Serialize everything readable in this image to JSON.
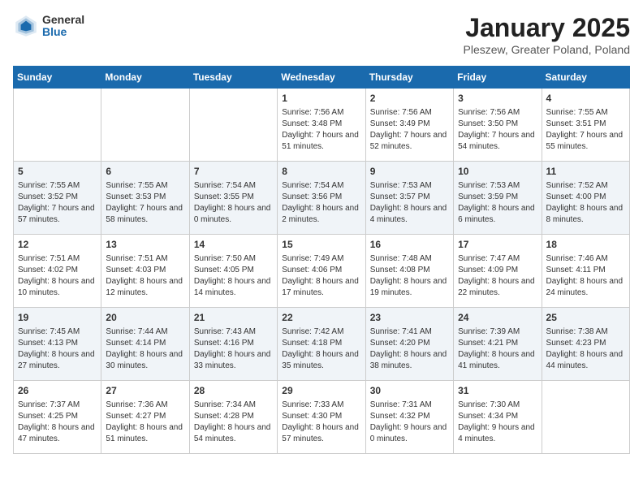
{
  "logo": {
    "general": "General",
    "blue": "Blue"
  },
  "title": "January 2025",
  "subtitle": "Pleszew, Greater Poland, Poland",
  "days_header": [
    "Sunday",
    "Monday",
    "Tuesday",
    "Wednesday",
    "Thursday",
    "Friday",
    "Saturday"
  ],
  "weeks": [
    [
      {
        "num": "",
        "sunrise": "",
        "sunset": "",
        "daylight": ""
      },
      {
        "num": "",
        "sunrise": "",
        "sunset": "",
        "daylight": ""
      },
      {
        "num": "",
        "sunrise": "",
        "sunset": "",
        "daylight": ""
      },
      {
        "num": "1",
        "sunrise": "Sunrise: 7:56 AM",
        "sunset": "Sunset: 3:48 PM",
        "daylight": "Daylight: 7 hours and 51 minutes."
      },
      {
        "num": "2",
        "sunrise": "Sunrise: 7:56 AM",
        "sunset": "Sunset: 3:49 PM",
        "daylight": "Daylight: 7 hours and 52 minutes."
      },
      {
        "num": "3",
        "sunrise": "Sunrise: 7:56 AM",
        "sunset": "Sunset: 3:50 PM",
        "daylight": "Daylight: 7 hours and 54 minutes."
      },
      {
        "num": "4",
        "sunrise": "Sunrise: 7:55 AM",
        "sunset": "Sunset: 3:51 PM",
        "daylight": "Daylight: 7 hours and 55 minutes."
      }
    ],
    [
      {
        "num": "5",
        "sunrise": "Sunrise: 7:55 AM",
        "sunset": "Sunset: 3:52 PM",
        "daylight": "Daylight: 7 hours and 57 minutes."
      },
      {
        "num": "6",
        "sunrise": "Sunrise: 7:55 AM",
        "sunset": "Sunset: 3:53 PM",
        "daylight": "Daylight: 7 hours and 58 minutes."
      },
      {
        "num": "7",
        "sunrise": "Sunrise: 7:54 AM",
        "sunset": "Sunset: 3:55 PM",
        "daylight": "Daylight: 8 hours and 0 minutes."
      },
      {
        "num": "8",
        "sunrise": "Sunrise: 7:54 AM",
        "sunset": "Sunset: 3:56 PM",
        "daylight": "Daylight: 8 hours and 2 minutes."
      },
      {
        "num": "9",
        "sunrise": "Sunrise: 7:53 AM",
        "sunset": "Sunset: 3:57 PM",
        "daylight": "Daylight: 8 hours and 4 minutes."
      },
      {
        "num": "10",
        "sunrise": "Sunrise: 7:53 AM",
        "sunset": "Sunset: 3:59 PM",
        "daylight": "Daylight: 8 hours and 6 minutes."
      },
      {
        "num": "11",
        "sunrise": "Sunrise: 7:52 AM",
        "sunset": "Sunset: 4:00 PM",
        "daylight": "Daylight: 8 hours and 8 minutes."
      }
    ],
    [
      {
        "num": "12",
        "sunrise": "Sunrise: 7:51 AM",
        "sunset": "Sunset: 4:02 PM",
        "daylight": "Daylight: 8 hours and 10 minutes."
      },
      {
        "num": "13",
        "sunrise": "Sunrise: 7:51 AM",
        "sunset": "Sunset: 4:03 PM",
        "daylight": "Daylight: 8 hours and 12 minutes."
      },
      {
        "num": "14",
        "sunrise": "Sunrise: 7:50 AM",
        "sunset": "Sunset: 4:05 PM",
        "daylight": "Daylight: 8 hours and 14 minutes."
      },
      {
        "num": "15",
        "sunrise": "Sunrise: 7:49 AM",
        "sunset": "Sunset: 4:06 PM",
        "daylight": "Daylight: 8 hours and 17 minutes."
      },
      {
        "num": "16",
        "sunrise": "Sunrise: 7:48 AM",
        "sunset": "Sunset: 4:08 PM",
        "daylight": "Daylight: 8 hours and 19 minutes."
      },
      {
        "num": "17",
        "sunrise": "Sunrise: 7:47 AM",
        "sunset": "Sunset: 4:09 PM",
        "daylight": "Daylight: 8 hours and 22 minutes."
      },
      {
        "num": "18",
        "sunrise": "Sunrise: 7:46 AM",
        "sunset": "Sunset: 4:11 PM",
        "daylight": "Daylight: 8 hours and 24 minutes."
      }
    ],
    [
      {
        "num": "19",
        "sunrise": "Sunrise: 7:45 AM",
        "sunset": "Sunset: 4:13 PM",
        "daylight": "Daylight: 8 hours and 27 minutes."
      },
      {
        "num": "20",
        "sunrise": "Sunrise: 7:44 AM",
        "sunset": "Sunset: 4:14 PM",
        "daylight": "Daylight: 8 hours and 30 minutes."
      },
      {
        "num": "21",
        "sunrise": "Sunrise: 7:43 AM",
        "sunset": "Sunset: 4:16 PM",
        "daylight": "Daylight: 8 hours and 33 minutes."
      },
      {
        "num": "22",
        "sunrise": "Sunrise: 7:42 AM",
        "sunset": "Sunset: 4:18 PM",
        "daylight": "Daylight: 8 hours and 35 minutes."
      },
      {
        "num": "23",
        "sunrise": "Sunrise: 7:41 AM",
        "sunset": "Sunset: 4:20 PM",
        "daylight": "Daylight: 8 hours and 38 minutes."
      },
      {
        "num": "24",
        "sunrise": "Sunrise: 7:39 AM",
        "sunset": "Sunset: 4:21 PM",
        "daylight": "Daylight: 8 hours and 41 minutes."
      },
      {
        "num": "25",
        "sunrise": "Sunrise: 7:38 AM",
        "sunset": "Sunset: 4:23 PM",
        "daylight": "Daylight: 8 hours and 44 minutes."
      }
    ],
    [
      {
        "num": "26",
        "sunrise": "Sunrise: 7:37 AM",
        "sunset": "Sunset: 4:25 PM",
        "daylight": "Daylight: 8 hours and 47 minutes."
      },
      {
        "num": "27",
        "sunrise": "Sunrise: 7:36 AM",
        "sunset": "Sunset: 4:27 PM",
        "daylight": "Daylight: 8 hours and 51 minutes."
      },
      {
        "num": "28",
        "sunrise": "Sunrise: 7:34 AM",
        "sunset": "Sunset: 4:28 PM",
        "daylight": "Daylight: 8 hours and 54 minutes."
      },
      {
        "num": "29",
        "sunrise": "Sunrise: 7:33 AM",
        "sunset": "Sunset: 4:30 PM",
        "daylight": "Daylight: 8 hours and 57 minutes."
      },
      {
        "num": "30",
        "sunrise": "Sunrise: 7:31 AM",
        "sunset": "Sunset: 4:32 PM",
        "daylight": "Daylight: 9 hours and 0 minutes."
      },
      {
        "num": "31",
        "sunrise": "Sunrise: 7:30 AM",
        "sunset": "Sunset: 4:34 PM",
        "daylight": "Daylight: 9 hours and 4 minutes."
      },
      {
        "num": "",
        "sunrise": "",
        "sunset": "",
        "daylight": ""
      }
    ]
  ]
}
